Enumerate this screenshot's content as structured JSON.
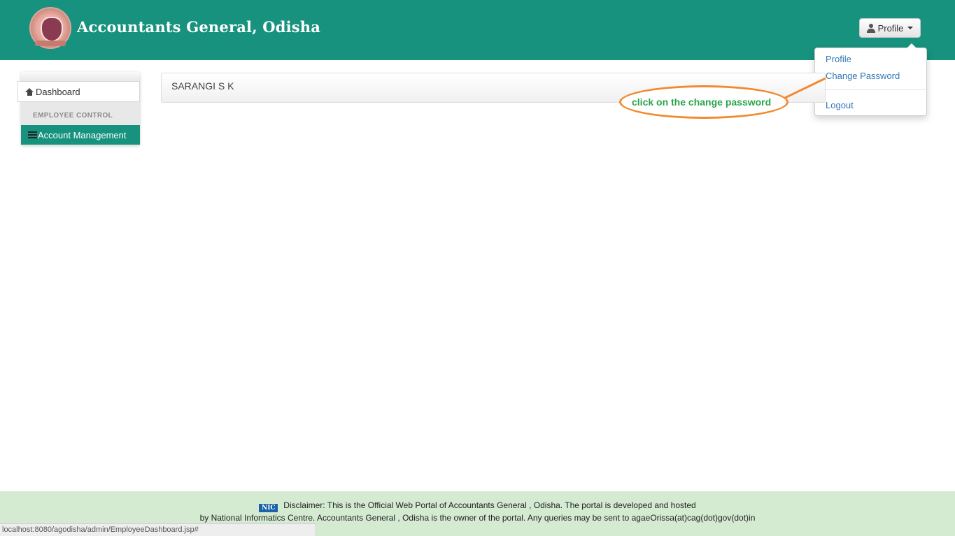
{
  "header": {
    "title": "Accountants General, Odisha",
    "profile_button": "Profile"
  },
  "dropdown": {
    "items": [
      {
        "label": "Profile"
      },
      {
        "label": "Change Password"
      },
      {
        "label": "Logout"
      }
    ]
  },
  "sidebar": {
    "dashboard": "Dashboard",
    "section_title": "EMPLOYEE CONTROL",
    "account_management": "Account Management"
  },
  "main": {
    "user_name": "SARANGI S K"
  },
  "annotation": {
    "text": "click on the change password"
  },
  "footer": {
    "nic_logo": "NIC",
    "line1": "Disclaimer: This is the Official Web Portal of Accountants General , Odisha. The portal is developed and hosted",
    "line2": "by National Informatics Centre. Accountants General , Odisha is the owner of the portal. Any queries may be sent to agaeOrissa(at)cag(dot)gov(dot)in"
  },
  "status_bar": {
    "url": "localhost:8080/agodisha/admin/EmployeeDashboard.jsp#"
  },
  "colors": {
    "brand_teal": "#17927e",
    "footer_green": "#d4ead1",
    "link_blue": "#3277b3",
    "annotation_orange": "#f28a30",
    "annotation_text": "#2aa44a"
  }
}
